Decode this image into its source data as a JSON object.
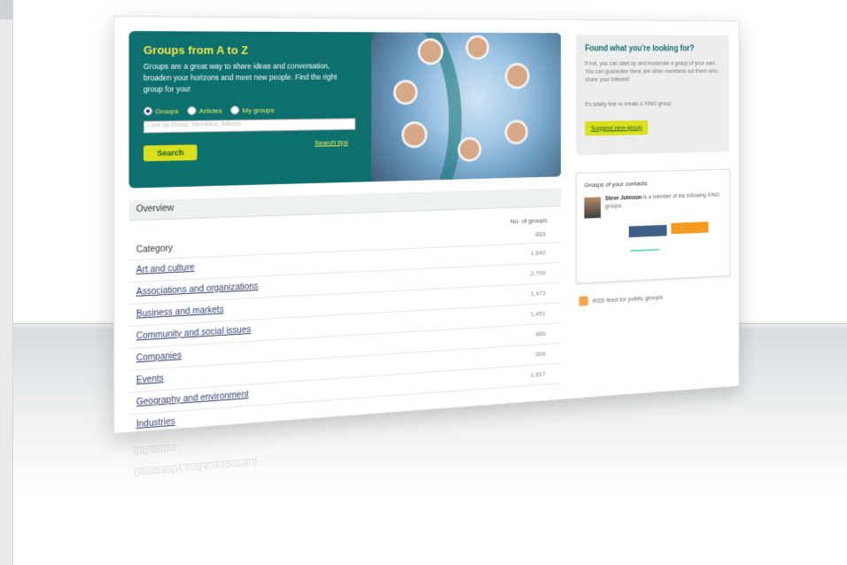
{
  "banner": {
    "title": "Groups from A to Z",
    "text": "Groups are a great way to share ideas and conversation, broaden your horizons and meet new people. Find the right group for you!",
    "radio_groups": "Groups",
    "radio_articles": "Articles",
    "radio_my_groups": "My groups",
    "search_placeholder": "Look up Group, Members, Articles",
    "search_tips": "Search tips",
    "search_button": "Search"
  },
  "overview": {
    "title": "Overview",
    "col_groups": "No. of groups",
    "category_label": "Category",
    "category_count": "833",
    "rows": [
      {
        "label": "Art and culture",
        "count": "1,840"
      },
      {
        "label": "Associations and organizations",
        "count": "2,799"
      },
      {
        "label": "Business and markets",
        "count": "1,473"
      },
      {
        "label": "Community and social issues",
        "count": "1,451"
      },
      {
        "label": "Companies",
        "count": "486"
      },
      {
        "label": "Events",
        "count": "568"
      },
      {
        "label": "Geography and environment",
        "count": "1,817"
      },
      {
        "label": "Industries",
        "count": ""
      }
    ]
  },
  "sidebar": {
    "found_title": "Found what you're looking for?",
    "found_text": "If not, you can start up and moderate a group of your own. You can guarantee there are other members out there who share your interest!",
    "found_text2": "It's totally free to create a XING group.",
    "suggest_button": "Suggest new group",
    "contacts_title": "Groups of your contacts",
    "member_name": "Steve Johnson",
    "member_text": "is a member of the following XING groups:",
    "rss_text": "RSS feed for public groups"
  },
  "reflection": [
    "Industries",
    "Geography and environment"
  ]
}
